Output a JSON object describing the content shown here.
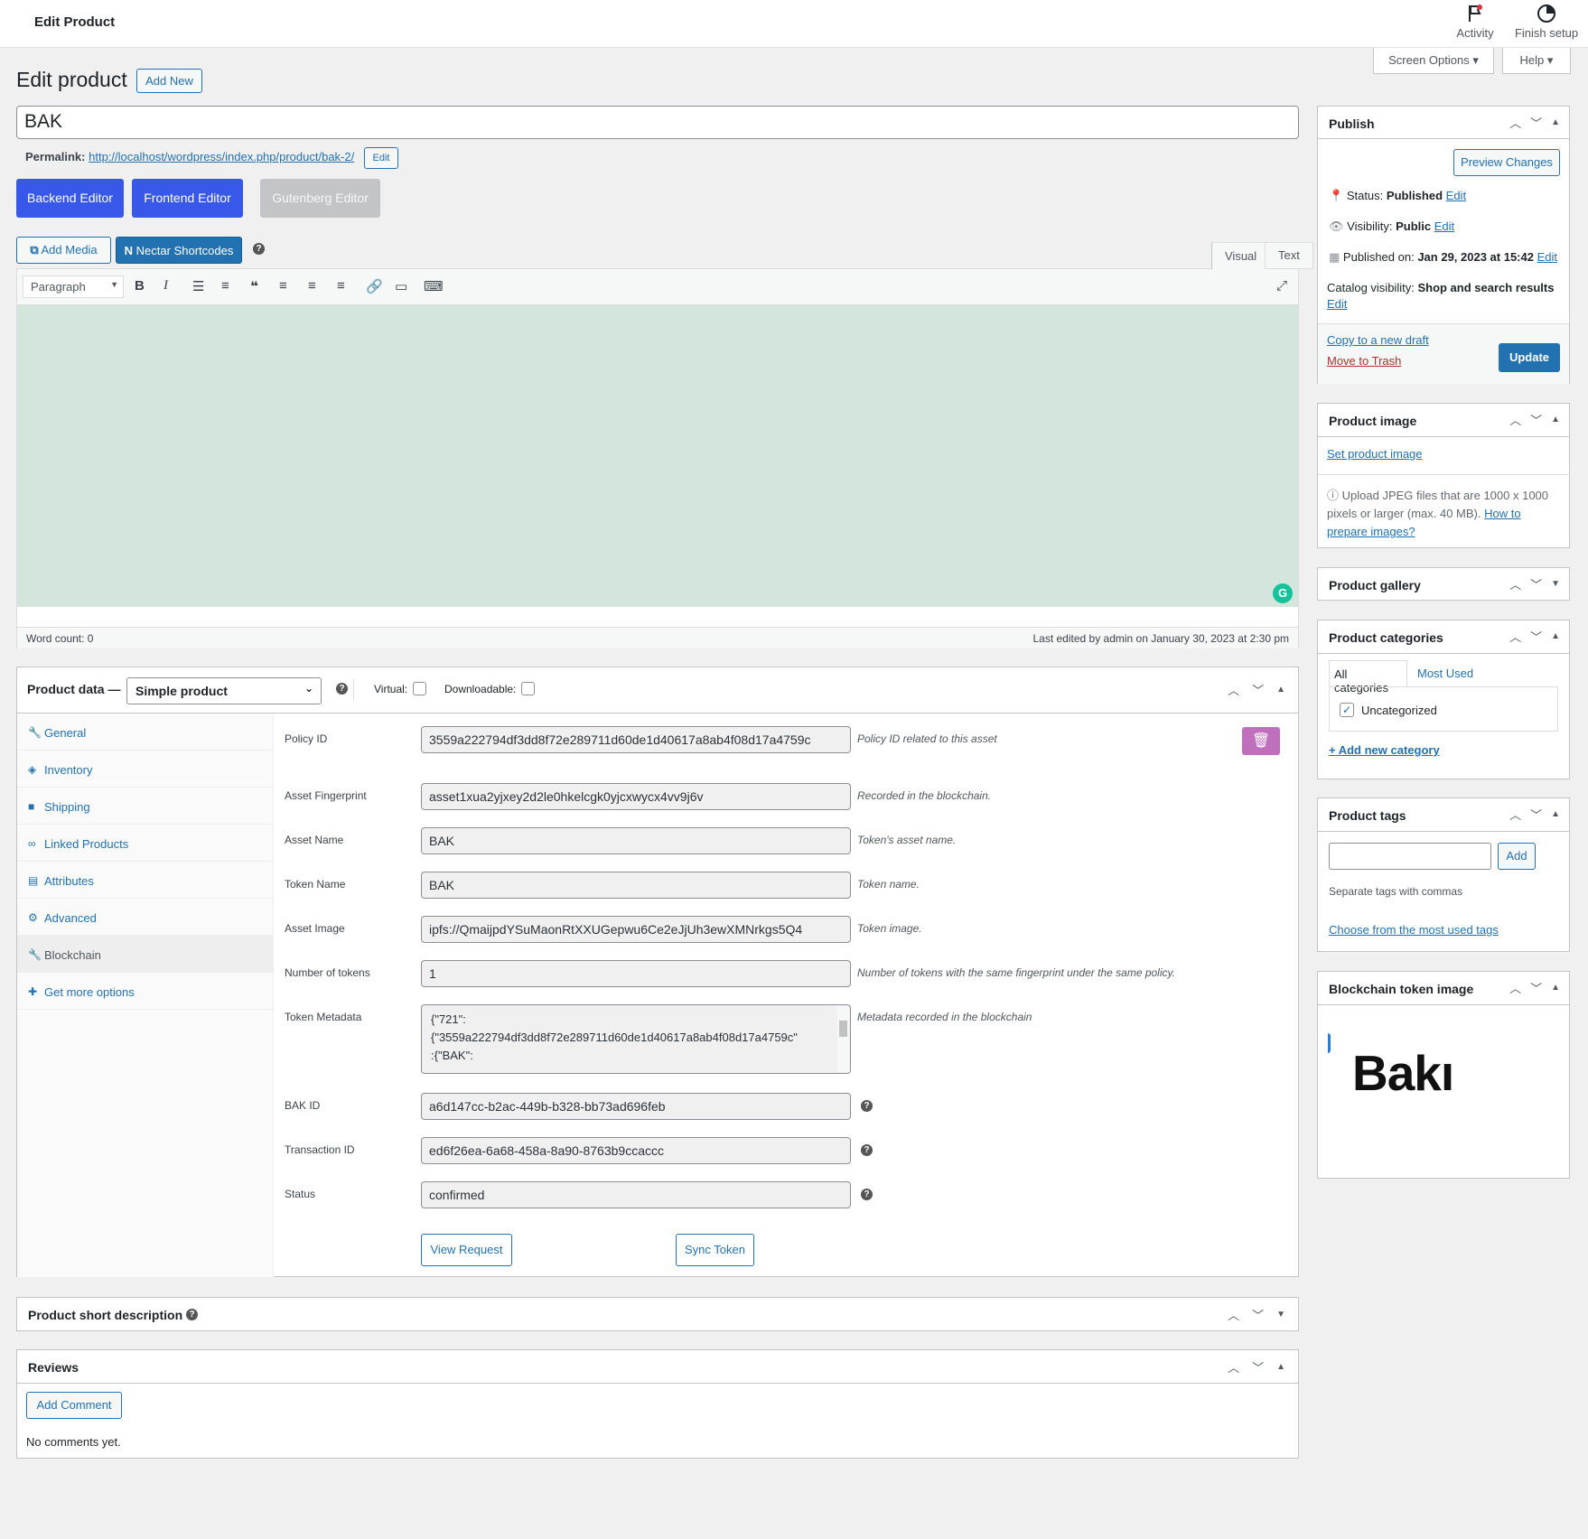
{
  "topbar": {
    "title": "Edit Product",
    "activity": "Activity",
    "finish_setup": "Finish setup"
  },
  "screen_options": "Screen Options",
  "help": "Help",
  "page_title": "Edit product",
  "add_new": "Add New",
  "product_title": "BAK",
  "permalink": {
    "label": "Permalink:",
    "url": "http://localhost/wordpress/index.php/product/bak-2/",
    "edit": "Edit"
  },
  "editors": {
    "backend": "Backend Editor",
    "frontend": "Frontend Editor",
    "gutenberg": "Gutenberg Editor"
  },
  "media": {
    "add_media": "Add Media",
    "nectar": "Nectar Shortcodes"
  },
  "editor_tabs": {
    "visual": "Visual",
    "text": "Text"
  },
  "toolbar": {
    "format": "Paragraph"
  },
  "editor_footer": {
    "word_count": "Word count: 0",
    "last_edited": "Last edited by admin on January 30, 2023 at 2:30 pm"
  },
  "product_data": {
    "label": "Product data —",
    "type": "Simple product",
    "virtual": "Virtual:",
    "downloadable": "Downloadable:",
    "tabs": [
      "General",
      "Inventory",
      "Shipping",
      "Linked Products",
      "Attributes",
      "Advanced",
      "Blockchain",
      "Get more options"
    ],
    "fields": {
      "policy_id": {
        "label": "Policy ID",
        "value": "3559a222794df3dd8f72e289711d60de1d40617a8ab4f08d17a4759c",
        "desc": "Policy ID related to this asset"
      },
      "fingerprint": {
        "label": "Asset Fingerprint",
        "value": "asset1xua2yjxey2d2le0hkelcgk0yjcxwycx4vv9j6v",
        "desc": "Recorded in the blockchain."
      },
      "asset_name": {
        "label": "Asset Name",
        "value": "BAK",
        "desc": "Token's asset name."
      },
      "token_name": {
        "label": "Token Name",
        "value": "BAK",
        "desc": "Token name."
      },
      "asset_image": {
        "label": "Asset Image",
        "value": "ipfs://QmaijpdYSuMaonRtXXUGepwu6Ce2eJjUh3ewXMNrkgs5Q4",
        "desc": "Token image."
      },
      "num_tokens": {
        "label": "Number of tokens",
        "value": "1",
        "desc": "Number of tokens with the same fingerprint under the same policy."
      },
      "metadata": {
        "label": "Token Metadata",
        "line1": "{\"721\":",
        "line2": "{\"3559a222794df3dd8f72e289711d60de1d40617a8ab4f08d17a4759c\"",
        "line3": ":{\"BAK\":",
        "desc": "Metadata recorded in the blockchain"
      },
      "bak_id": {
        "label": "BAK ID",
        "value": "a6d147cc-b2ac-449b-b328-bb73ad696feb"
      },
      "tx_id": {
        "label": "Transaction ID",
        "value": "ed6f26ea-6a68-458a-8a90-8763b9ccaccc"
      },
      "status": {
        "label": "Status",
        "value": "confirmed"
      }
    },
    "view_request": "View Request",
    "sync_token": "Sync Token"
  },
  "short_desc": "Product short description",
  "reviews": {
    "title": "Reviews",
    "add_comment": "Add Comment",
    "none": "No comments yet."
  },
  "publish": {
    "title": "Publish",
    "preview": "Preview Changes",
    "status_label": "Status:",
    "status": "Published",
    "visibility_label": "Visibility:",
    "visibility": "Public",
    "published_label": "Published on:",
    "published": "Jan 29, 2023 at 15:42",
    "catalog_label": "Catalog visibility:",
    "catalog": "Shop and search results",
    "edit": "Edit",
    "copy": "Copy to a new draft",
    "trash": "Move to Trash",
    "update": "Update"
  },
  "product_image": {
    "title": "Product image",
    "set": "Set product image",
    "hint": "Upload JPEG files that are 1000 x 1000 pixels or larger (max. 40 MB).",
    "how1": "How to",
    "how2": "prepare images?"
  },
  "gallery": {
    "title": "Product gallery"
  },
  "categories": {
    "title": "Product categories",
    "all": "All categories",
    "most": "Most Used",
    "uncat": "Uncategorized",
    "add": "+ Add new category"
  },
  "tags": {
    "title": "Product tags",
    "add": "Add",
    "hint": "Separate tags with commas",
    "choose": "Choose from the most used tags"
  },
  "token_image": {
    "title": "Blockchain token image",
    "logo": "Bakı"
  },
  "colors": {
    "blue": "#2271b1",
    "editor_blue": "#3858e9",
    "editor_bg": "#d3e5dd",
    "delete": "#c06fbd"
  }
}
